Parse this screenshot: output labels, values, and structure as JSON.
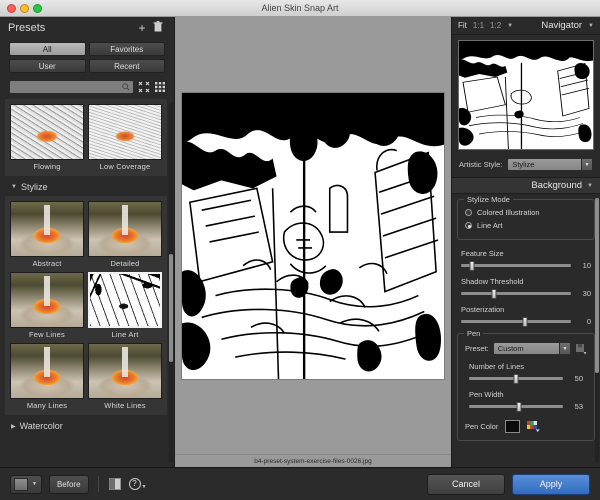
{
  "window": {
    "title": "Alien Skin Snap Art",
    "traffic_lights": [
      "close",
      "minimize",
      "zoom"
    ]
  },
  "presets_panel": {
    "title": "Presets",
    "add_icon": "plus-icon",
    "delete_icon": "trash-icon",
    "filters": [
      {
        "label": "All",
        "active": true
      },
      {
        "label": "Favorites",
        "active": false
      },
      {
        "label": "User",
        "active": false
      },
      {
        "label": "Recent",
        "active": false
      }
    ],
    "search": {
      "value": "",
      "placeholder": ""
    },
    "view_icons": [
      "collapse-all-icon",
      "grid-view-icon"
    ],
    "groups": [
      {
        "name": "",
        "expanded": true,
        "items": [
          {
            "label": "Flowing",
            "art": "noise",
            "selected": false
          },
          {
            "label": "Low Coverage",
            "art": "lowcov",
            "selected": false
          }
        ]
      },
      {
        "name": "Stylize",
        "expanded": true,
        "items": [
          {
            "label": "Abstract",
            "art": "photo",
            "selected": false
          },
          {
            "label": "Detailed",
            "art": "photo",
            "selected": false
          },
          {
            "label": "Few Lines",
            "art": "photo",
            "selected": false
          },
          {
            "label": "Line Art",
            "art": "lineart",
            "selected": true
          },
          {
            "label": "Many Lines",
            "art": "photo",
            "selected": false
          },
          {
            "label": "White Lines",
            "art": "photo",
            "selected": false
          }
        ]
      },
      {
        "name": "Watercolor",
        "expanded": false,
        "items": []
      }
    ]
  },
  "canvas": {
    "filename": "b4-preset-system-exercise-files-0026.jpg"
  },
  "navigator": {
    "zoom_options": [
      {
        "label": "Fit",
        "active": true
      },
      {
        "label": "1:1",
        "active": false
      },
      {
        "label": "1:2",
        "active": false
      }
    ],
    "zoom_dropdown_icon": "chevron-down-icon",
    "title": "Navigator",
    "collapse_icon": "chevron-down-icon"
  },
  "artistic_style": {
    "label": "Artistic Style:",
    "value": "Stylize"
  },
  "settings": {
    "section_title": "Background",
    "section_collapse_icon": "chevron-down-icon",
    "stylize_mode": {
      "legend": "Stylize Mode",
      "options": [
        {
          "label": "Colored Illustration",
          "selected": false
        },
        {
          "label": "Line Art",
          "selected": true
        }
      ]
    },
    "sliders": [
      {
        "label": "Feature Size",
        "value": "10",
        "percent": 10
      },
      {
        "label": "Shadow Threshold",
        "value": "30",
        "percent": 30
      },
      {
        "label": "Posterization",
        "value": "0",
        "percent": 58
      }
    ],
    "pen": {
      "legend": "Pen",
      "preset_label": "Preset:",
      "preset_value": "Custom",
      "preset_extra_icon": "save-preset-icon",
      "sliders": [
        {
          "label": "Number of Lines",
          "value": "50",
          "percent": 50
        },
        {
          "label": "Pen Width",
          "value": "53",
          "percent": 53
        }
      ],
      "color_label": "Pen Color",
      "color_swatch": "#0b0b0b",
      "color_picker_icon": "color-picker-icon"
    }
  },
  "bottom_bar": {
    "view_mode_icon": "single-view-icon",
    "view_mode_dropdown_icon": "chevron-down-icon",
    "before_label": "Before",
    "split_view_icon": "split-view-icon",
    "help_icon": "help-question-icon",
    "help_dropdown_icon": "chevron-down-icon",
    "cancel_label": "Cancel",
    "apply_label": "Apply",
    "accent_color": "#3d7cc9"
  }
}
